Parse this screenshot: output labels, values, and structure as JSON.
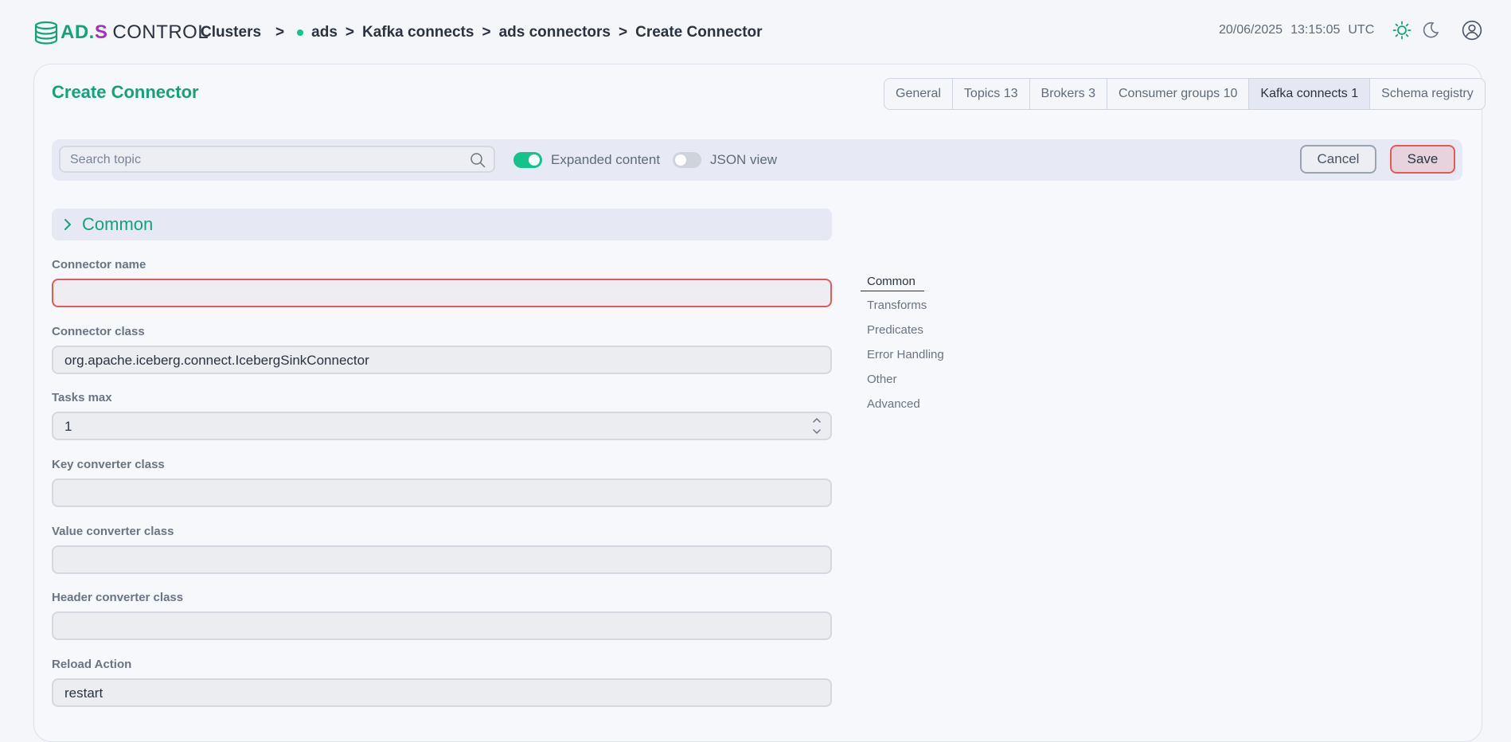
{
  "header": {
    "logo": {
      "ad": "AD",
      "dot": ".",
      "s": "S",
      "control": "CONTROL"
    },
    "breadcrumb": {
      "clusters": "Clusters",
      "sep": ">",
      "cluster": "ads",
      "kafka_connects": "Kafka connects",
      "connectors": "ads connectors",
      "current": "Create Connector"
    },
    "date": "20/06/2025",
    "time": "13:15:05",
    "tz": "UTC",
    "icons": [
      "sun-icon",
      "moon-icon",
      "user-icon"
    ]
  },
  "page": {
    "title": "Create Connector",
    "tabs": [
      {
        "label": "General",
        "active": false
      },
      {
        "label": "Topics 13",
        "active": false
      },
      {
        "label": "Brokers 3",
        "active": false
      },
      {
        "label": "Consumer groups 10",
        "active": false
      },
      {
        "label": "Kafka connects 1",
        "active": true
      },
      {
        "label": "Schema registry",
        "active": false
      }
    ]
  },
  "toolbar": {
    "search_placeholder": "Search topic",
    "expanded_label": "Expanded content",
    "expanded_on": true,
    "json_label": "JSON view",
    "json_on": false,
    "cancel_label": "Cancel",
    "save_label": "Save"
  },
  "form": {
    "section_title": "Common",
    "fields": [
      {
        "label": "Connector name",
        "value": "",
        "error": true
      },
      {
        "label": "Connector class",
        "value": "org.apache.iceberg.connect.IcebergSinkConnector"
      },
      {
        "label": "Tasks max",
        "value": "1"
      },
      {
        "label": "Key converter class",
        "value": ""
      },
      {
        "label": "Value converter class",
        "value": ""
      },
      {
        "label": "Header converter class",
        "value": ""
      },
      {
        "label": "Reload Action",
        "value": "restart"
      }
    ]
  },
  "side_nav": {
    "items": [
      "Common",
      "Transforms",
      "Predicates",
      "Error Handling",
      "Other",
      "Advanced"
    ],
    "active": "Common"
  },
  "colors": {
    "accent": "#12a37a",
    "error": "#e05a5a",
    "toggle_on": "#12c48a"
  }
}
